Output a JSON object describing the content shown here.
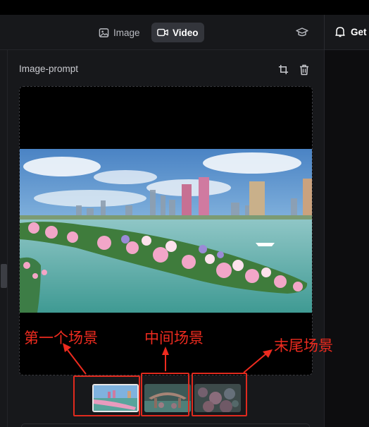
{
  "topbar": {
    "modes": [
      {
        "label": "Image",
        "icon": "image-icon",
        "active": false
      },
      {
        "label": "Video",
        "icon": "video-camera-icon",
        "active": true
      }
    ],
    "learn_icon": "graduation-cap-icon",
    "get_label": "Get",
    "get_icon": "bell-icon"
  },
  "prompt_panel": {
    "title": "Image-prompt",
    "actions": [
      "crop-icon",
      "trash-icon"
    ],
    "thumbnails": [
      "first-scene",
      "middle-scene",
      "last-scene"
    ],
    "selected_thumbnail": 0
  },
  "annotations": {
    "first_scene": "第一个场景",
    "middle_scene": "中间场景",
    "last_scene": "末尾场景",
    "color": "#ee2b1f"
  },
  "colors": {
    "background": "#111214",
    "panel": "#17181b",
    "active_tab": "#33353b",
    "annotation_red": "#e02a1e"
  }
}
